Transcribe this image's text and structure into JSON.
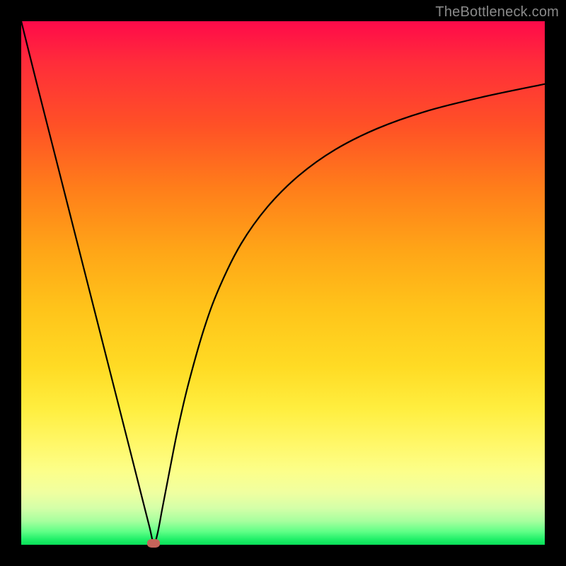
{
  "watermark": {
    "text": "TheBottleneck.com"
  },
  "chart_data": {
    "type": "line",
    "title": "",
    "xlabel": "",
    "ylabel": "",
    "xlim": [
      0,
      100
    ],
    "ylim": [
      0,
      100
    ],
    "grid": false,
    "background_gradient": {
      "direction": "vertical",
      "stops": [
        {
          "pos": 0.0,
          "color": "#ff0a4a"
        },
        {
          "pos": 0.5,
          "color": "#ffc41a"
        },
        {
          "pos": 0.86,
          "color": "#fcff8a"
        },
        {
          "pos": 1.0,
          "color": "#0adf59"
        }
      ]
    },
    "series": [
      {
        "name": "bottleneck-curve",
        "color": "#000000",
        "x": [
          0.0,
          3.0,
          6.0,
          9.0,
          12.0,
          15.0,
          18.0,
          21.0,
          23.0,
          24.5,
          25.3,
          26.0,
          27.0,
          28.5,
          30.0,
          32.0,
          35.0,
          38.0,
          42.0,
          47.0,
          53.0,
          60.0,
          68.0,
          77.0,
          88.0,
          100.0
        ],
        "y": [
          100.0,
          88.0,
          76.2,
          64.4,
          52.6,
          40.8,
          29.0,
          17.2,
          9.3,
          3.4,
          0.3,
          2.0,
          7.2,
          15.0,
          22.5,
          31.0,
          41.5,
          49.5,
          57.5,
          64.5,
          70.5,
          75.5,
          79.5,
          82.7,
          85.5,
          88.0
        ]
      }
    ],
    "markers": [
      {
        "name": "optimal-point",
        "x": 25.3,
        "y": 0.3,
        "shape": "ellipse",
        "color": "#c5645a"
      }
    ]
  }
}
